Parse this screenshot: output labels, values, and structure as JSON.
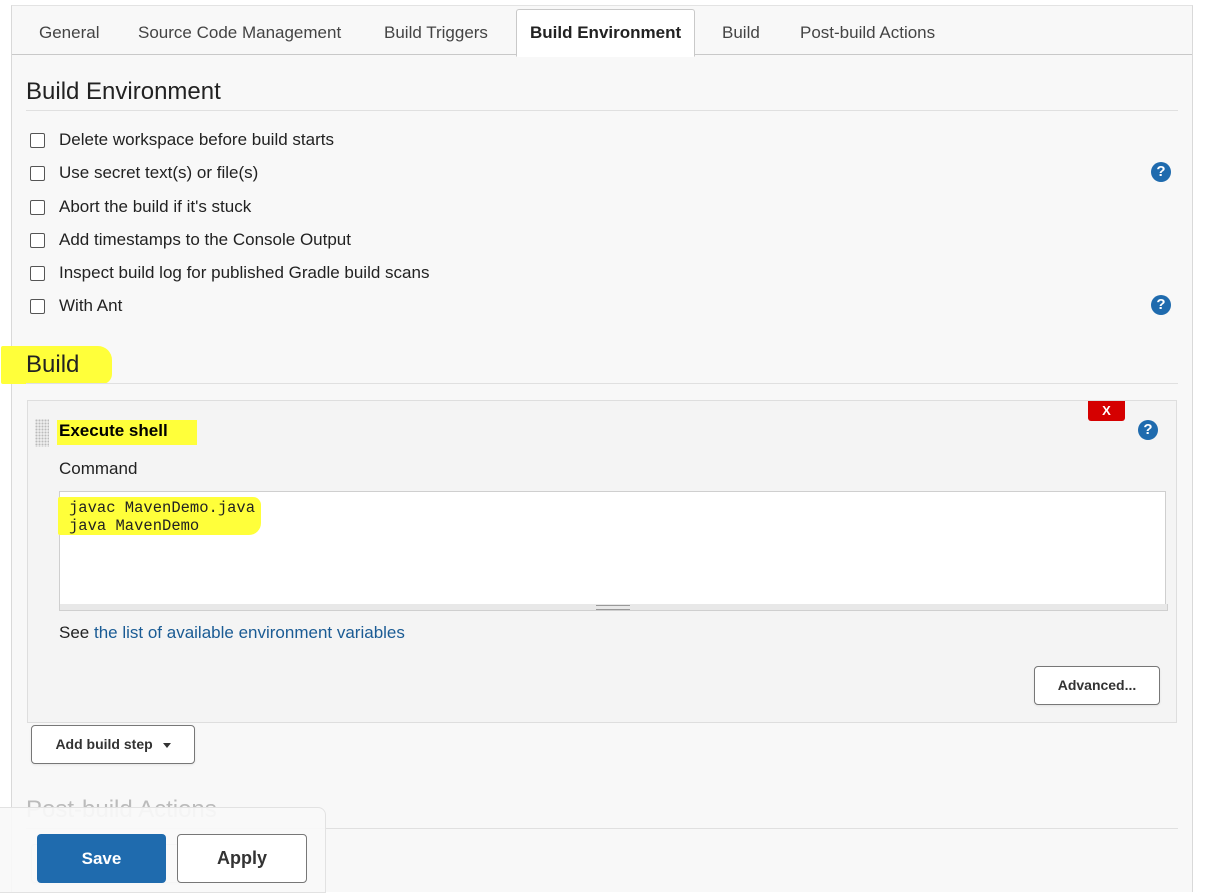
{
  "tabs": [
    {
      "label": "General"
    },
    {
      "label": "Source Code Management"
    },
    {
      "label": "Build Triggers"
    },
    {
      "label": "Build Environment"
    },
    {
      "label": "Build"
    },
    {
      "label": "Post-build Actions"
    }
  ],
  "active_tab": "Build Environment",
  "build_environment": {
    "title": "Build Environment",
    "options": [
      {
        "label": "Delete workspace before build starts",
        "checked": false
      },
      {
        "label": "Use secret text(s) or file(s)",
        "checked": false
      },
      {
        "label": "Abort the build if it's stuck",
        "checked": false
      },
      {
        "label": "Add timestamps to the Console Output",
        "checked": false
      },
      {
        "label": "Inspect build log for published Gradle build scans",
        "checked": false
      },
      {
        "label": "With Ant",
        "checked": false
      }
    ],
    "help_glyph": "?"
  },
  "build": {
    "title": "Build",
    "step": {
      "title": "Execute shell",
      "delete_label": "X",
      "help_glyph": "?",
      "command_label": "Command",
      "command_value": "javac MavenDemo.java\njava MavenDemo",
      "see_prefix": "See ",
      "see_link": "the list of available environment variables",
      "advanced_label": "Advanced..."
    },
    "add_step_label": "Add build step"
  },
  "post_build": {
    "title": "Post-build Actions"
  },
  "footer": {
    "save_label": "Save",
    "apply_label": "Apply"
  },
  "colors": {
    "accent": "#1f6bae",
    "highlight": "#ffff3a",
    "delete": "#d50000"
  }
}
